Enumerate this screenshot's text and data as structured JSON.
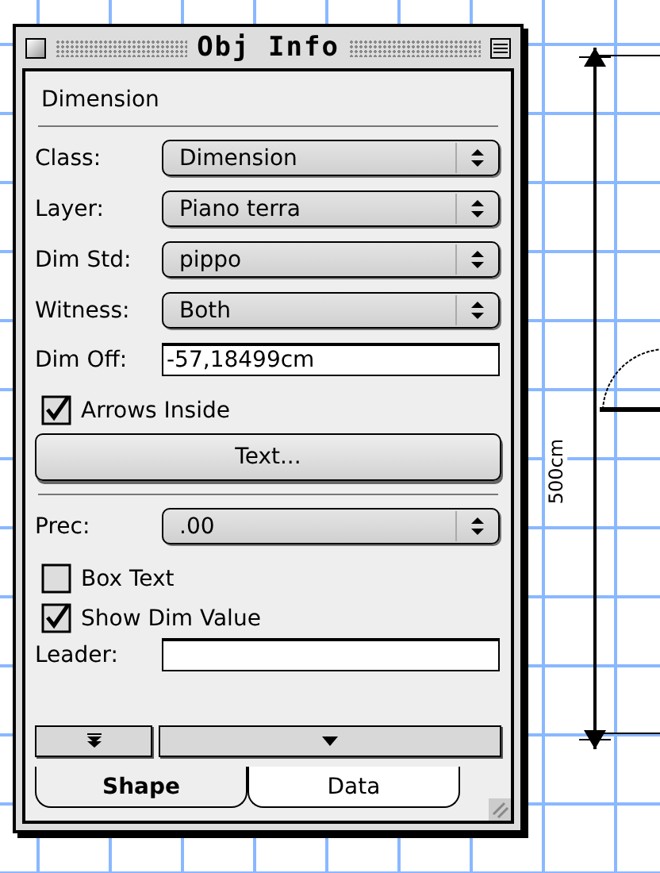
{
  "window": {
    "title": "Obj Info"
  },
  "object_type": "Dimension",
  "controls": [
    {
      "kind": "popup",
      "label": "Class:",
      "value": "Dimension"
    },
    {
      "kind": "popup",
      "label": "Layer:",
      "value": "Piano terra"
    },
    {
      "kind": "popup",
      "label": "Dim Std:",
      "value": "pippo"
    },
    {
      "kind": "popup",
      "label": "Witness:",
      "value": "Both"
    },
    {
      "kind": "text",
      "label": "Dim Off:",
      "value": "-57,18499cm"
    },
    {
      "kind": "checkbox",
      "label": "Arrows Inside",
      "checked": true
    },
    {
      "kind": "button",
      "label": "Text..."
    },
    {
      "kind": "divider"
    },
    {
      "kind": "popup",
      "label": "Prec:",
      "value": ".00"
    },
    {
      "kind": "checkbox",
      "label": "Box Text",
      "checked": false
    },
    {
      "kind": "checkbox",
      "label": "Show Dim Value",
      "checked": true
    },
    {
      "kind": "text",
      "label": "Leader:"
    }
  ],
  "tabs": [
    {
      "label": "Shape",
      "selected": true
    },
    {
      "label": "Data",
      "selected": false
    }
  ],
  "drawing": {
    "dimension_label": "500cm"
  }
}
